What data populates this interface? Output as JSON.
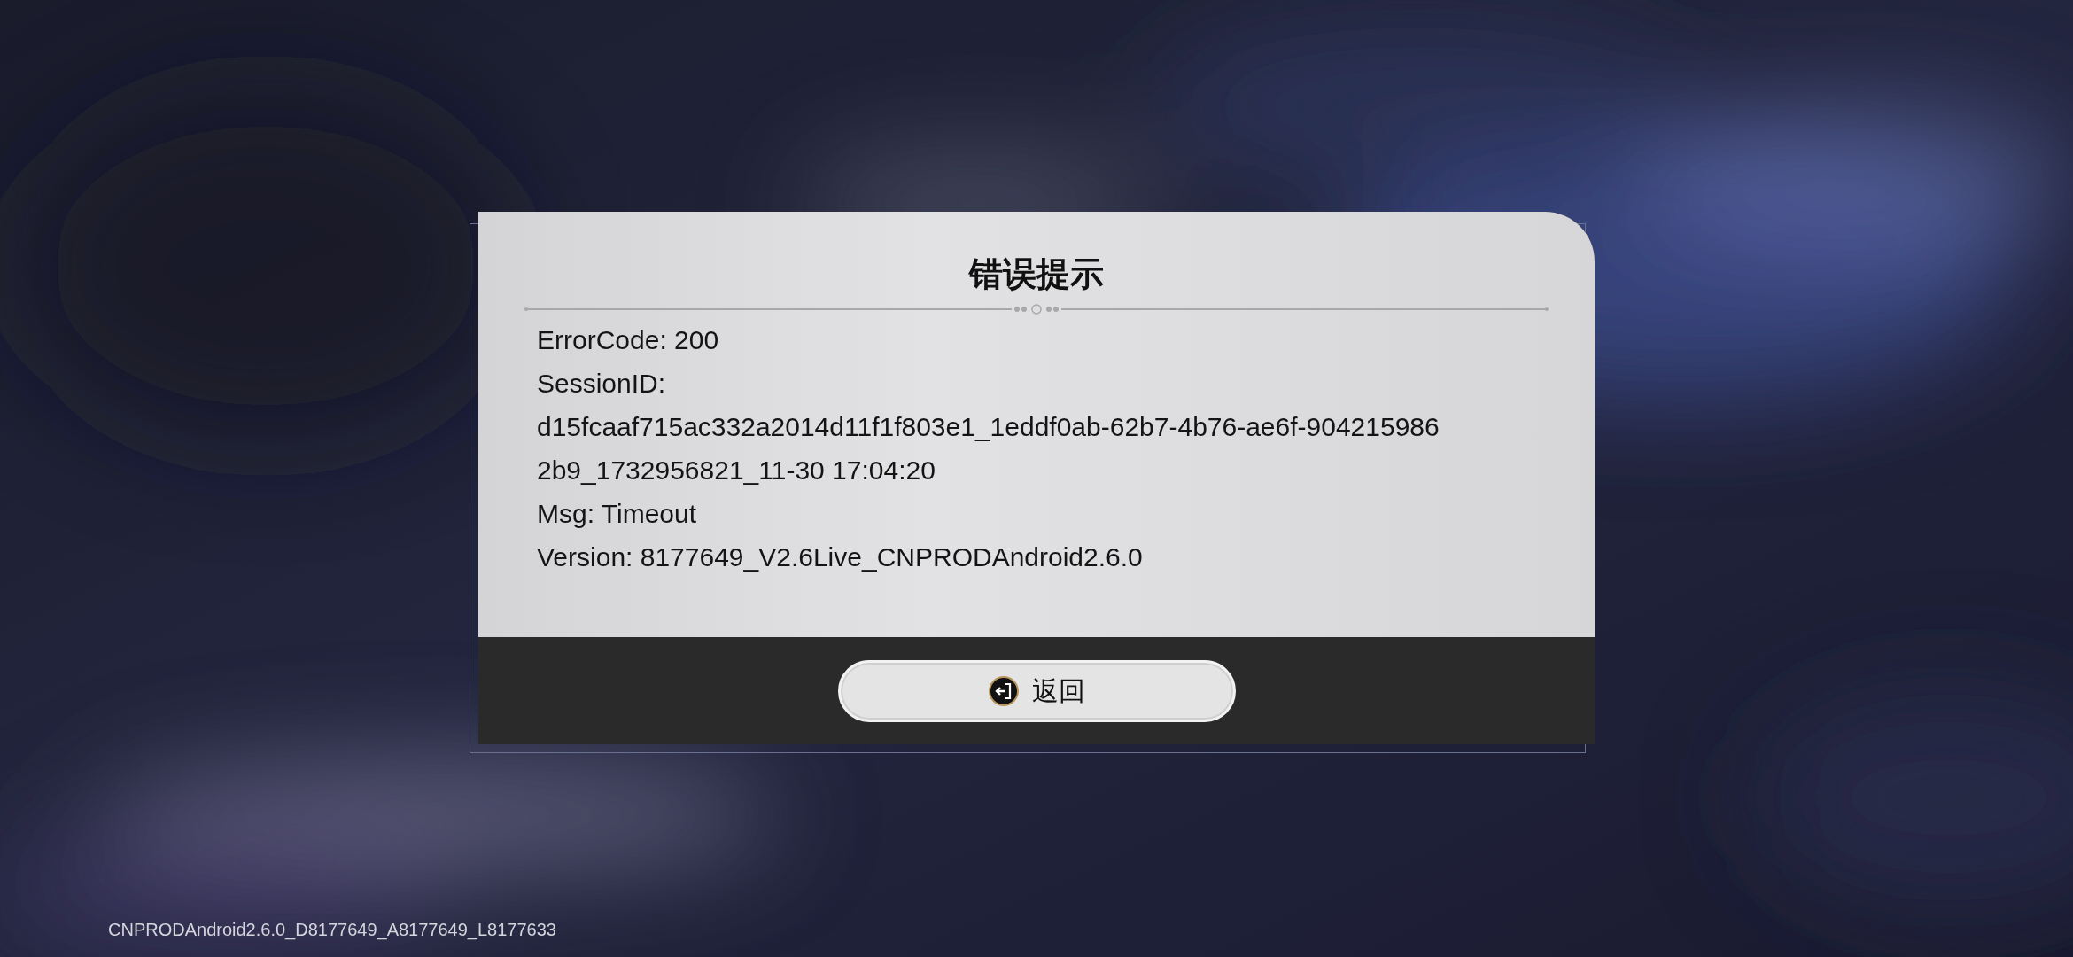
{
  "dialog": {
    "title": "错误提示",
    "lines": [
      "ErrorCode: 200",
      "SessionID:",
      "d15fcaaf715ac332a2014d11f1f803e1_1eddf0ab-62b7-4b76-ae6f-904215986",
      "2b9_1732956821_11-30 17:04:20",
      "Msg: Timeout",
      "Version: 8177649_V2.6Live_CNPRODAndroid2.6.0"
    ],
    "button": {
      "label": "返回"
    }
  },
  "build_info": "CNPRODAndroid2.6.0_D8177649_A8177649_L8177633"
}
